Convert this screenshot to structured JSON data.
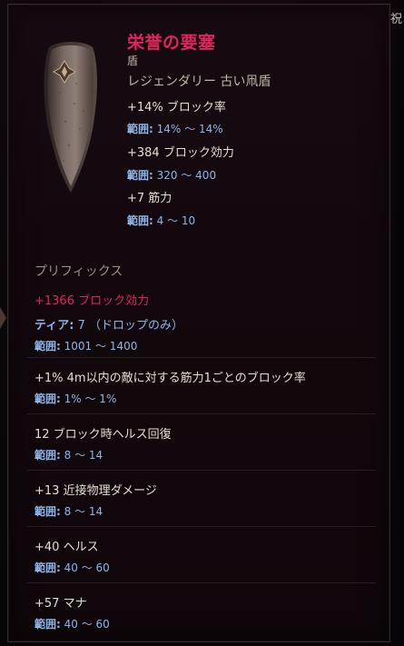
{
  "tooltip": {
    "corner_glyph": "祝",
    "item": {
      "name": "栄誉の要塞",
      "type": "盾",
      "subtitle": "レジェンダリー 古い凧盾",
      "image_icon": "kite-shield-icon",
      "implicit_stats": [
        {
          "text": "+14% ブロック率",
          "range_label": "範囲:",
          "range": "14% 〜 14%"
        },
        {
          "text": "+384 ブロック効力",
          "range_label": "範囲:",
          "range": "320 〜 400"
        },
        {
          "text": "+7 筋力",
          "range_label": "範囲:",
          "range": "4 〜 10"
        }
      ]
    },
    "prefix_section": {
      "title": "プリフィックス",
      "affixes": [
        {
          "text": "+1366 ブロック効力",
          "tier_label": "ティア:",
          "tier": "7 （ドロップのみ）",
          "range_label": "範囲:",
          "range": "1001 〜 1400"
        },
        {
          "text": "+1% 4m以内の敵に対する筋力1ごとのブロック率",
          "range_label": "範囲:",
          "range": "1% 〜 1%"
        },
        {
          "text": "12 ブロック時ヘルス回復",
          "range_label": "範囲:",
          "range": "8 〜 14"
        },
        {
          "text": "+13 近接物理ダメージ",
          "range_label": "範囲:",
          "range": "8 〜 14"
        },
        {
          "text": "+40 ヘルス",
          "range_label": "範囲:",
          "range": "40 〜 60"
        },
        {
          "text": "+57 マナ",
          "range_label": "範囲:",
          "range": "40 〜 60"
        }
      ]
    },
    "colors": {
      "legendary_name": "#e0245e",
      "range_blue": "#8fb4e8",
      "stat_text": "#e4dfd4",
      "muted_text": "#bdb5a8"
    }
  }
}
